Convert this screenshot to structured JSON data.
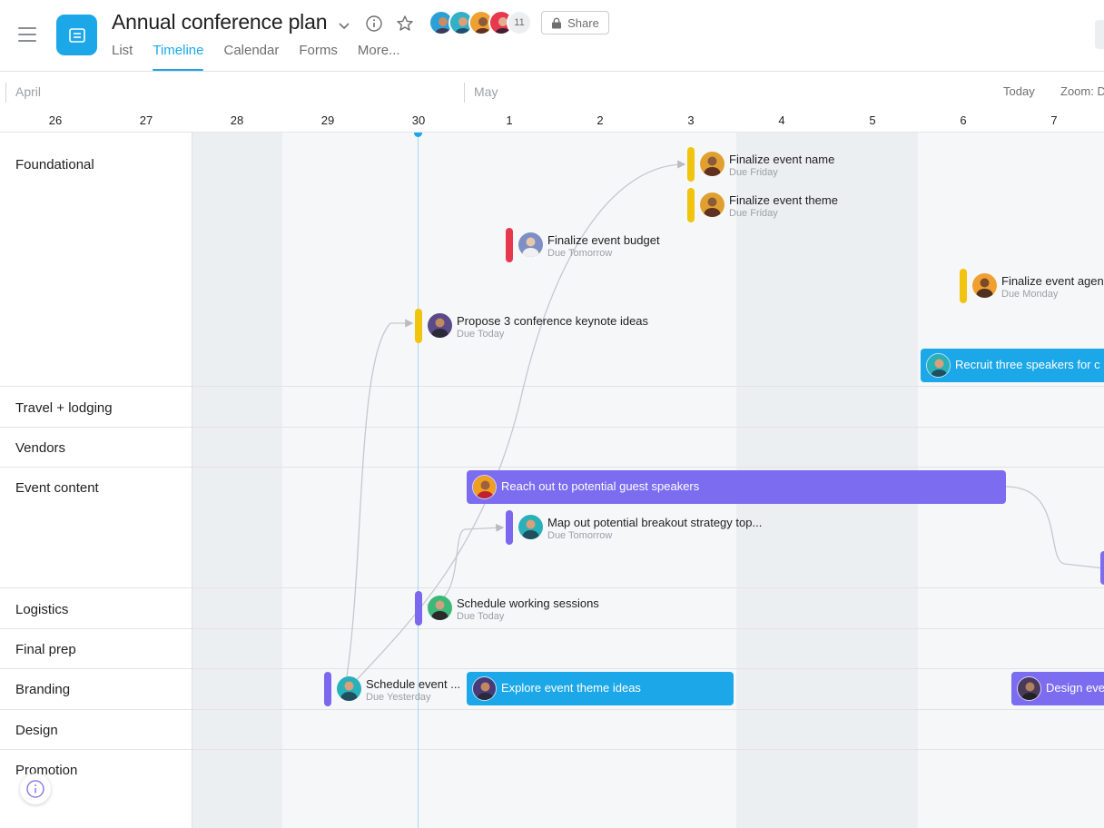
{
  "header": {
    "title": "Annual conference plan",
    "tabs": [
      "List",
      "Timeline",
      "Calendar",
      "Forms",
      "More..."
    ],
    "active_tab": "Timeline",
    "member_count": "11",
    "share_label": "Share",
    "icons": {
      "menu": "hamburger-icon",
      "project": "list-icon",
      "dropdown": "chevron-down-icon",
      "info": "info-icon",
      "favorite": "star-icon",
      "share": "lock-icon"
    }
  },
  "timeline": {
    "months": [
      "April",
      "May"
    ],
    "days": [
      "26",
      "27",
      "28",
      "29",
      "30",
      "1",
      "2",
      "3",
      "4",
      "5",
      "6",
      "7"
    ],
    "today_label": "Today",
    "zoom_label": "Zoom: D"
  },
  "sections": [
    "Foundational",
    "Travel + lodging",
    "Vendors",
    "Event content",
    "Logistics",
    "Final prep",
    "Branding",
    "Design",
    "Promotion"
  ],
  "tasks": [
    {
      "name": "Finalize event name",
      "due": "Due Friday",
      "day": "3",
      "color": "#f1c40f",
      "avatar": "#e0a030"
    },
    {
      "name": "Finalize event theme",
      "due": "Due Friday",
      "day": "3",
      "color": "#f1c40f",
      "avatar": "#e0a030"
    },
    {
      "name": "Finalize event budget",
      "due": "Due Tomorrow",
      "day": "1",
      "color": "#e8384f",
      "avatar": "#7d8fc5"
    },
    {
      "name": "Finalize event agend",
      "due": "Due Monday",
      "day": "6",
      "color": "#f1c40f",
      "avatar": "#f0a030"
    },
    {
      "name": "Propose 3 conference keynote ideas",
      "due": "Due Today",
      "day": "30",
      "color": "#f1c40f",
      "avatar": "#5a4a8a"
    },
    {
      "name": "Map out potential breakout strategy top...",
      "due": "Due Tomorrow",
      "day": "1",
      "color": "#7b68ee",
      "avatar": "#2ab0b8"
    },
    {
      "name": "Schedule working sessions",
      "due": "Due Today",
      "day": "30",
      "color": "#7b68ee",
      "avatar": "#3cb878"
    },
    {
      "name": "Schedule event ...",
      "due": "Due Yesterday",
      "day": "29",
      "color": "#7b68ee",
      "avatar": "#2ab0b8"
    }
  ],
  "bars": [
    {
      "name": "Recruit three speakers for c",
      "color": "#1ba7e8",
      "avatar": "#2ab0b8"
    },
    {
      "name": "Reach out to potential guest speakers",
      "color": "#7b6cf0",
      "avatar": "#f0a020"
    },
    {
      "name": "Explore event theme ideas",
      "color": "#1ba7e8",
      "avatar": "#4a3a7a"
    },
    {
      "name": "Design eve",
      "color": "#7b6cf0",
      "avatar": "#4a3a5a"
    }
  ],
  "member_avatars": [
    "#2a9fd8",
    "#31b0c8",
    "#f0a030",
    "#e8384f"
  ],
  "colors": {
    "accent": "#1ba7e8",
    "purple": "#7b6cf0",
    "yellow": "#f1c40f",
    "red": "#e8384f"
  },
  "info_icon": "info-circle-icon"
}
